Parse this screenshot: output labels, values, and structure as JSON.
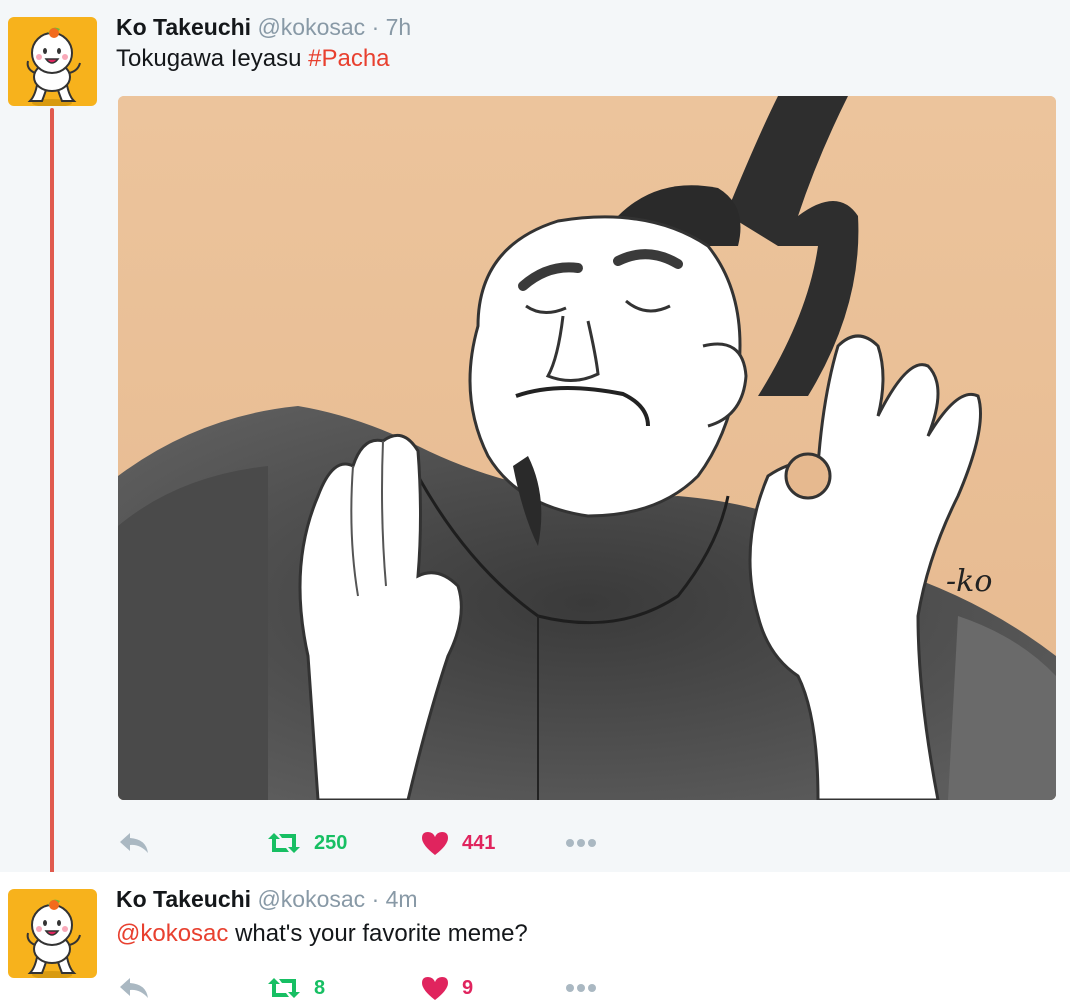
{
  "tweets": [
    {
      "name": "Ko Takeuchi",
      "handle": "@kokosac",
      "separator": "·",
      "time": "7h",
      "text_prefix": "Tokugawa Ieyasu ",
      "hashtag": "#Pacha",
      "retweets": "250",
      "likes": "441",
      "media_signature": "-ko"
    },
    {
      "name": "Ko Takeuchi",
      "handle": "@kokosac",
      "separator": "·",
      "time": "4m",
      "mention": "@kokosac",
      "text_suffix": " what's your favorite meme?",
      "retweets": "8",
      "likes": "9"
    }
  ],
  "icons": {
    "reply": "reply-icon",
    "retweet": "retweet-icon",
    "like": "heart-icon",
    "more": "more-dots-icon"
  },
  "colors": {
    "accent": "#e8402f",
    "retweet": "#17bf63",
    "like": "#e0245e",
    "muted": "#8899a6",
    "avatar_bg": "#f7b21c",
    "thread_line": "#e05a4e"
  }
}
